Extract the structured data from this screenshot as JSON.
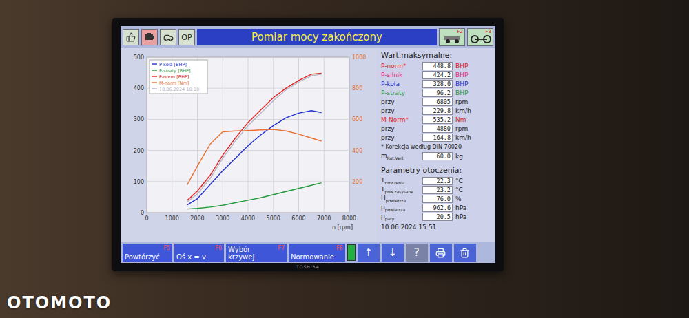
{
  "toolbar": {
    "mode_buttons": [
      {
        "kind": "thumb",
        "label": "",
        "selected": false
      },
      {
        "kind": "engine",
        "label": "",
        "selected": true
      },
      {
        "kind": "car",
        "label": "",
        "selected": false
      },
      {
        "kind": "text",
        "label": "OP",
        "selected": false
      }
    ],
    "title": "Pomiar mocy zakończony",
    "function_buttons": [
      {
        "key": "F2",
        "kind": "dyno"
      },
      {
        "key": "F3",
        "kind": "axle"
      }
    ]
  },
  "chart": {
    "y_ticks": [
      "0",
      "100",
      "200",
      "300",
      "400",
      "500"
    ],
    "y_right_ticks": [
      "200",
      "400",
      "600",
      "800",
      "1000"
    ],
    "x_ticks": [
      "0",
      "1000",
      "2000",
      "3000",
      "4000",
      "5000",
      "6000",
      "7000",
      "8000"
    ],
    "x_label": "n [rpm]",
    "rpm": [
      1600,
      2000,
      2500,
      3000,
      3500,
      4000,
      4500,
      5000,
      5500,
      6000,
      6500,
      6900
    ],
    "series": [
      {
        "label": "P-koła [BHP]",
        "color": "#2230d0",
        "axis": "left",
        "values": [
          25,
          45,
          90,
          135,
          175,
          215,
          250,
          280,
          305,
          320,
          328,
          322
        ]
      },
      {
        "label": "P-straty [BHP]",
        "color": "#1f9a3a",
        "axis": "left",
        "values": [
          12,
          14,
          18,
          24,
          32,
          40,
          48,
          58,
          68,
          78,
          88,
          96
        ]
      },
      {
        "label": "P-norm [BHP]",
        "color": "#e02020",
        "axis": "left",
        "values": [
          40,
          70,
          120,
          185,
          240,
          290,
          330,
          370,
          400,
          425,
          445,
          448
        ]
      },
      {
        "label": "M-norm [Nm]",
        "color": "#e87030",
        "axis": "right",
        "values": [
          180,
          300,
          440,
          520,
          525,
          528,
          532,
          535,
          525,
          505,
          480,
          460
        ]
      },
      {
        "label": "10.06.2024 10:18",
        "color": "#b4b4c4",
        "axis": "left",
        "values": [
          35,
          60,
          110,
          175,
          230,
          280,
          320,
          360,
          395,
          420,
          440,
          445
        ]
      }
    ]
  },
  "max_values": {
    "title": "Wart.maksymalne:",
    "rows": [
      {
        "label": "P-norm*",
        "value": "448.8",
        "unit": "BHP",
        "color": "#e02020"
      },
      {
        "label": "P-silnik",
        "value": "424.2",
        "unit": "BHP",
        "color": "#e0307a"
      },
      {
        "label": "P-koła",
        "value": "328.0",
        "unit": "BHP",
        "color": "#2230d0"
      },
      {
        "label": "P-straty",
        "value": "96.2",
        "unit": "BHP",
        "color": "#1f9a3a"
      },
      {
        "label": "przy",
        "value": "6805",
        "unit": "rpm",
        "color": "#222222"
      },
      {
        "label": "przy",
        "value": "229.8",
        "unit": "km/h",
        "color": "#222222"
      },
      {
        "label": "M-Norm*",
        "value": "535.2",
        "unit": "Nm",
        "color": "#e02020"
      },
      {
        "label": "przy",
        "value": "4880",
        "unit": "rpm",
        "color": "#222222"
      },
      {
        "label": "przy",
        "value": "164.8",
        "unit": "km/h",
        "color": "#222222"
      }
    ],
    "note": "* Korekcja według DIN 70020",
    "mass": {
      "label": "m",
      "sub": "Rot.Verl.",
      "value": "60.0",
      "unit": "kg"
    }
  },
  "environment": {
    "title": "Parametry otoczenia:",
    "rows": [
      {
        "label": "T",
        "sub": "otoczenia",
        "value": "22.3",
        "unit": "°C"
      },
      {
        "label": "T",
        "sub": "pow.zasysane",
        "value": "23.2",
        "unit": "°C"
      },
      {
        "label": "H",
        "sub": "powietrza",
        "value": "76.0",
        "unit": "%"
      },
      {
        "label": "p",
        "sub": "powietrza",
        "value": "962.6",
        "unit": "hPa"
      },
      {
        "label": "p",
        "sub": "pary",
        "value": "20.5",
        "unit": "hPa"
      }
    ],
    "timestamp": "10.06.2024  15:51"
  },
  "bottom_bar": {
    "buttons": [
      {
        "label": "Powtórzyć",
        "key": "F5"
      },
      {
        "label": "Oś x = v",
        "key": "F6"
      },
      {
        "label": "Wybór krzywej",
        "key": "F7"
      },
      {
        "label": "Normowanie",
        "key": "F8"
      }
    ],
    "indicator": {
      "on": true
    },
    "icon_buttons": [
      {
        "kind": "text",
        "label": "↑"
      },
      {
        "kind": "text",
        "label": "↓"
      },
      {
        "kind": "help",
        "label": "?"
      },
      {
        "kind": "printer",
        "label": ""
      },
      {
        "kind": "trash",
        "label": ""
      }
    ]
  },
  "monitor": {
    "brand": "TOSHIBA"
  },
  "watermark": "OTOMOTO"
}
